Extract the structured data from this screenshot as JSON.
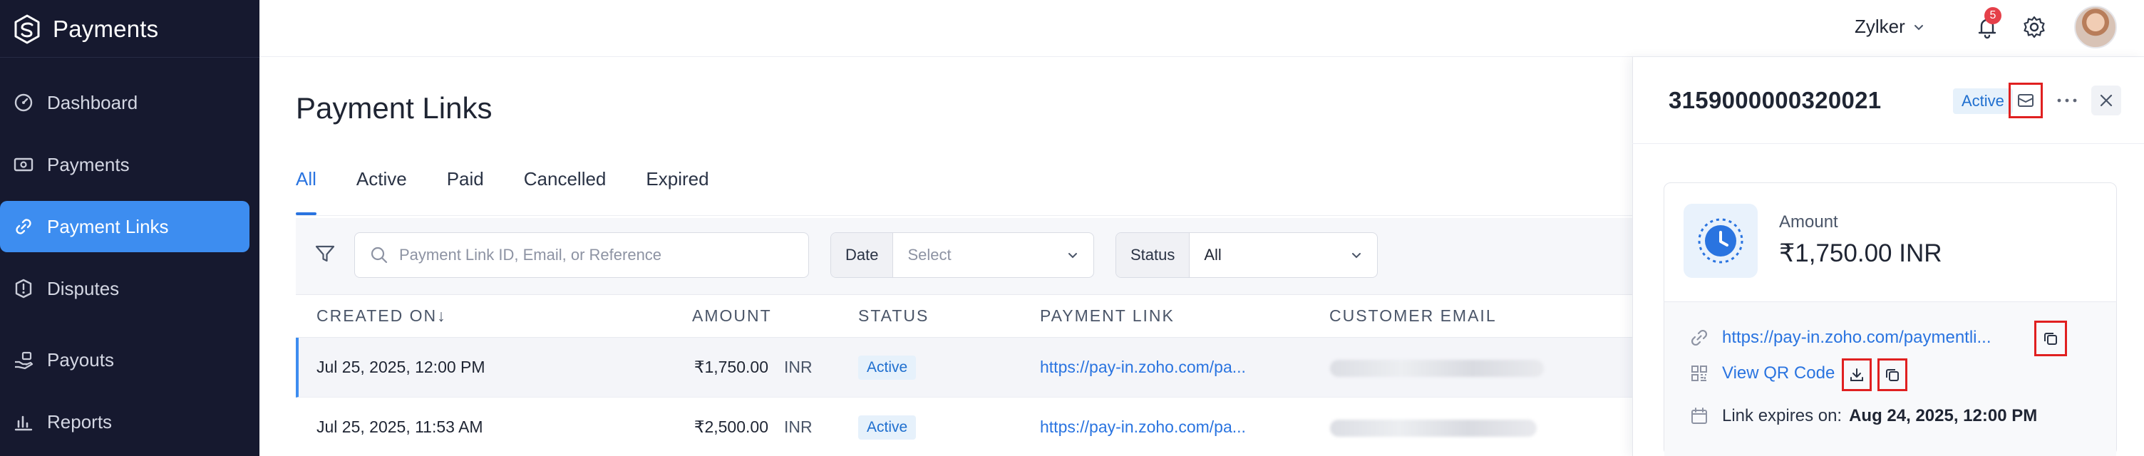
{
  "app": {
    "name": "Payments"
  },
  "sidebar": {
    "items": [
      {
        "label": "Dashboard",
        "icon": "dashboard-icon",
        "active": false
      },
      {
        "label": "Payments",
        "icon": "payments-icon",
        "active": false
      },
      {
        "label": "Payment Links",
        "icon": "link-icon",
        "active": true
      },
      {
        "label": "Disputes",
        "icon": "disputes-icon",
        "active": false
      },
      {
        "label": "Payouts",
        "icon": "payouts-icon",
        "active": false
      },
      {
        "label": "Reports",
        "icon": "reports-icon",
        "active": false
      }
    ]
  },
  "topbar": {
    "org_name": "Zylker",
    "notification_count": "5"
  },
  "page": {
    "title": "Payment Links"
  },
  "tabs": [
    {
      "label": "All",
      "active": true
    },
    {
      "label": "Active",
      "active": false
    },
    {
      "label": "Paid",
      "active": false
    },
    {
      "label": "Cancelled",
      "active": false
    },
    {
      "label": "Expired",
      "active": false
    }
  ],
  "filters": {
    "search_placeholder": "Payment Link ID, Email, or Reference",
    "date_label": "Date",
    "date_placeholder": "Select",
    "status_label": "Status",
    "status_value": "All"
  },
  "table": {
    "columns": [
      "CREATED ON",
      "AMOUNT",
      "STATUS",
      "PAYMENT LINK",
      "CUSTOMER EMAIL"
    ],
    "sort_indicator": "↓",
    "rows": [
      {
        "created_on": "Jul 25, 2025, 12:00 PM",
        "amount": "₹1,750.00",
        "currency": "INR",
        "status": "Active",
        "payment_link": "https://pay-in.zoho.com/pa...",
        "selected": true
      },
      {
        "created_on": "Jul 25, 2025, 11:53 AM",
        "amount": "₹2,500.00",
        "currency": "INR",
        "status": "Active",
        "payment_link": "https://pay-in.zoho.com/pa...",
        "selected": false
      }
    ]
  },
  "detail": {
    "id": "3159000000320021",
    "status": "Active",
    "amount_label": "Amount",
    "amount_value": "₹1,750.00 INR",
    "link": "https://pay-in.zoho.com/paymentli...",
    "qr_label": "View QR Code",
    "expiry_label": "Link expires on:",
    "expiry_value": "Aug 24, 2025, 12:00 PM"
  },
  "colors": {
    "sidebar_bg": "#16192f",
    "accent": "#3d8df0",
    "link": "#2a74e0",
    "highlight_box": "#e02020"
  }
}
